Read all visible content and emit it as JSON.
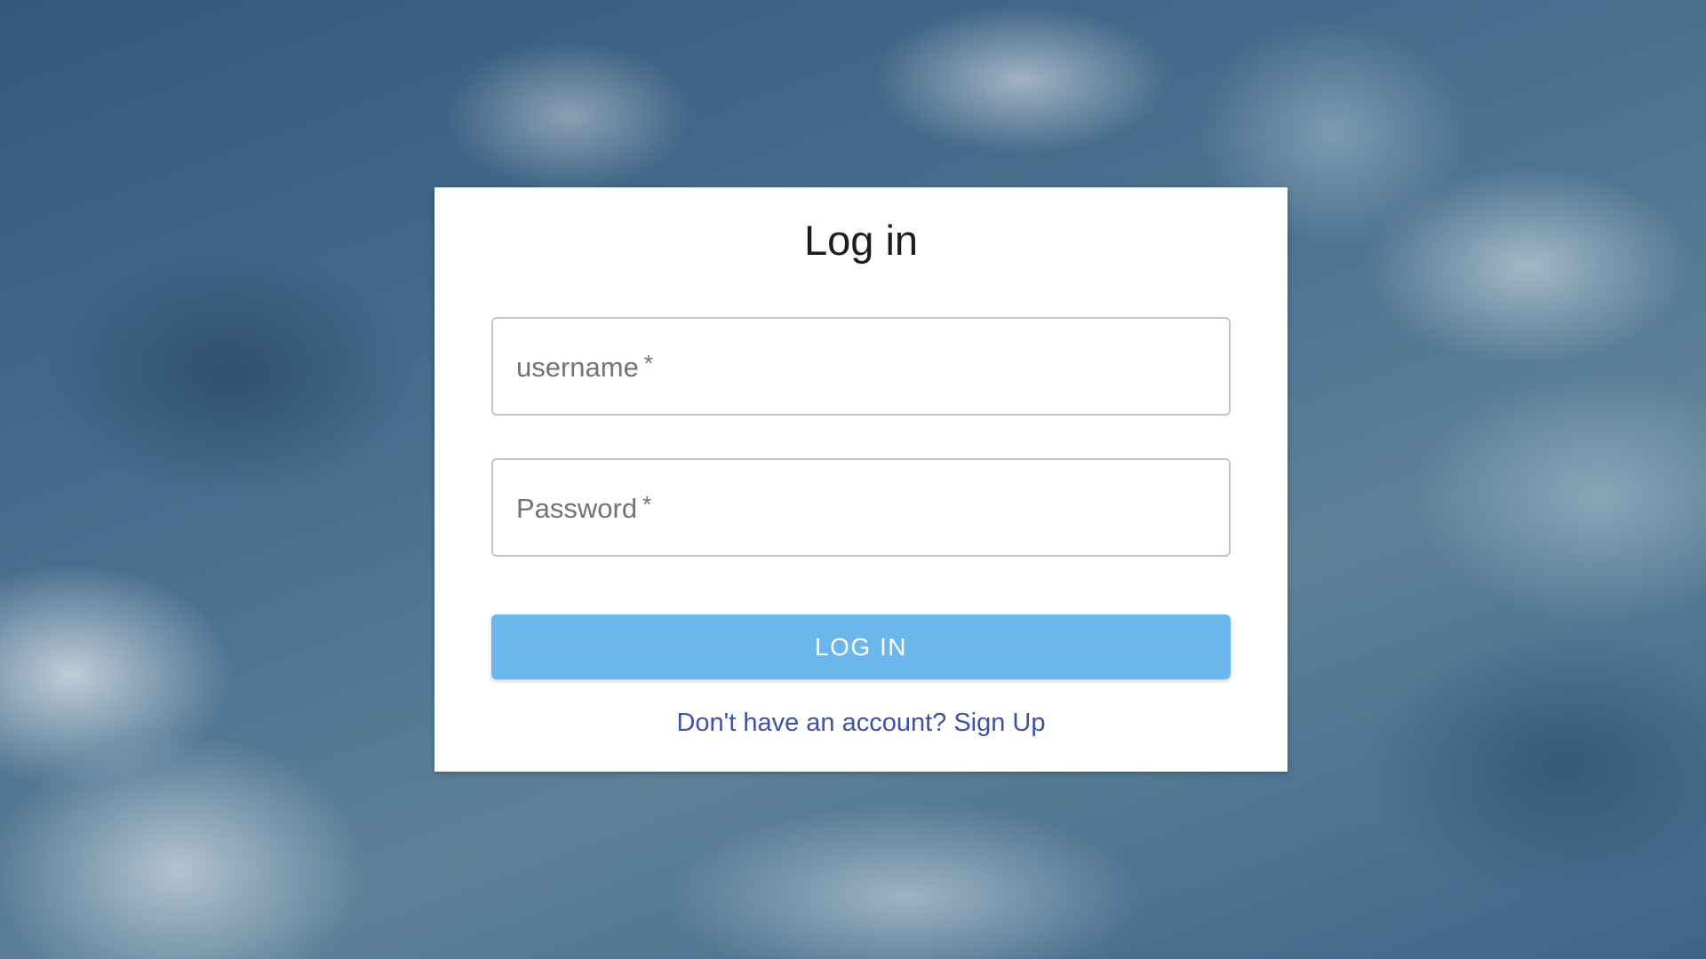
{
  "login": {
    "title": "Log in",
    "username_label": "username",
    "password_label": "Password",
    "required_marker": "*",
    "username_value": "",
    "password_value": "",
    "submit_label": "LOG IN",
    "signup_text": "Don't have an account? Sign Up"
  },
  "colors": {
    "button": "#6cb6ee",
    "link": "#3f51a5",
    "field_border": "#c4c4c4"
  }
}
